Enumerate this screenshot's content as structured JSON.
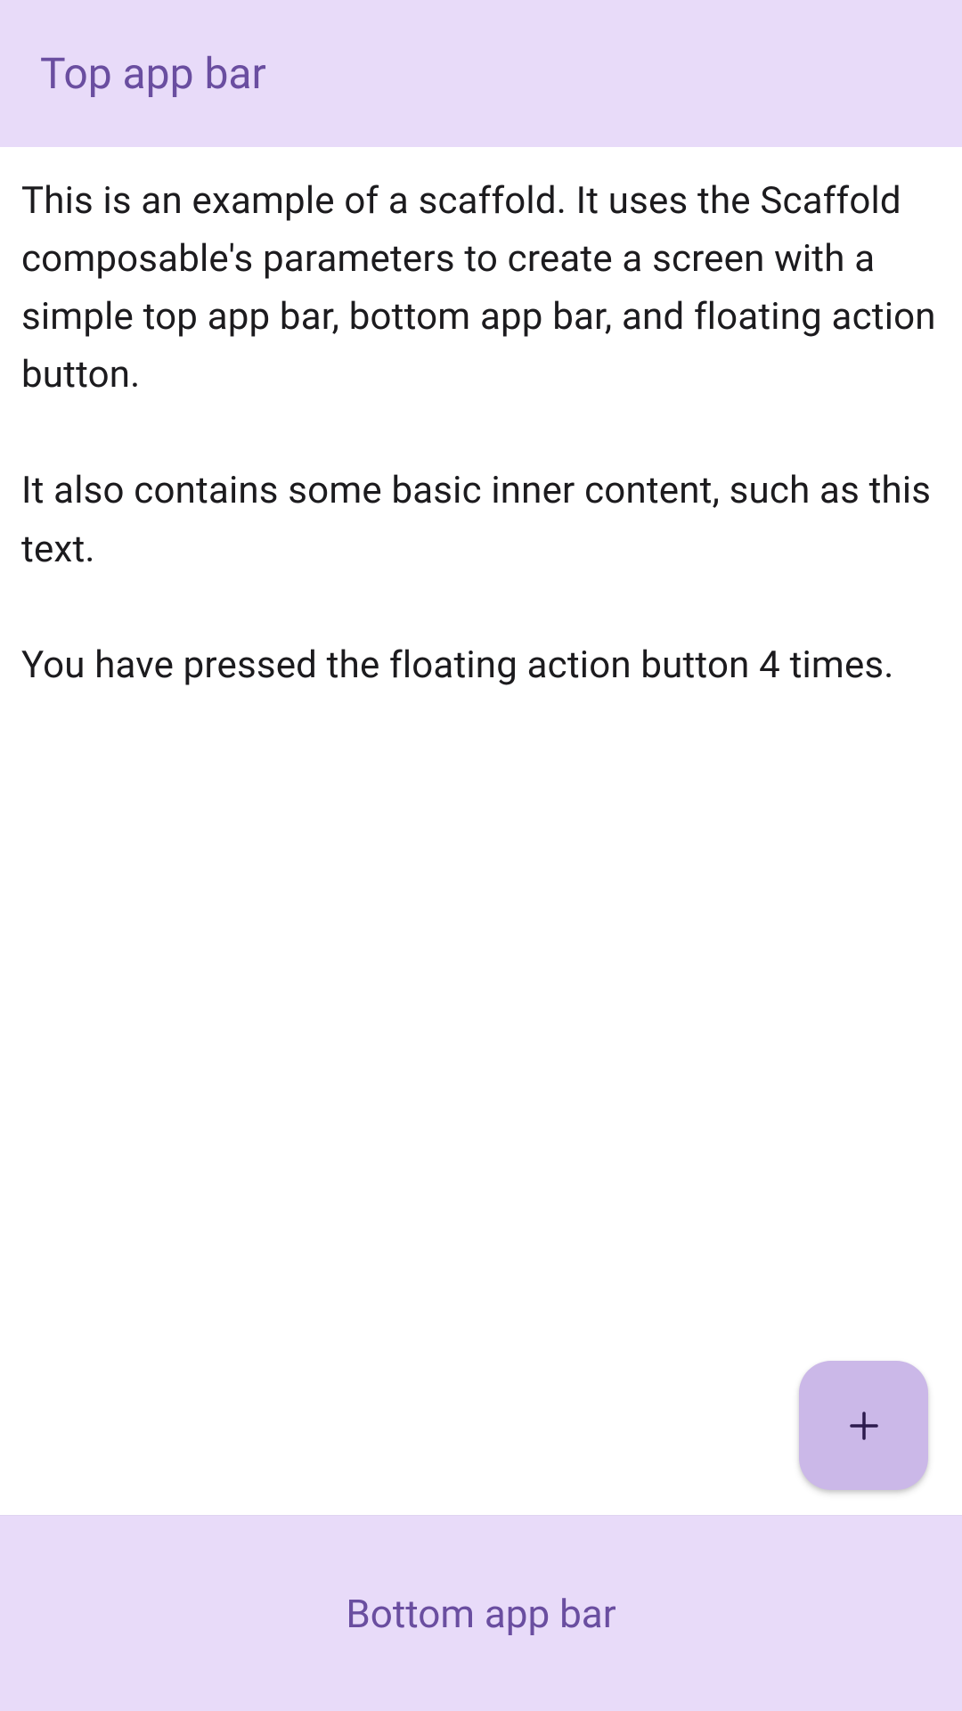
{
  "topBar": {
    "title": "Top app bar"
  },
  "content": {
    "paragraph1": "This is an example of a scaffold. It uses the Scaffold composable's parameters to create a screen with a simple top app bar, bottom app bar, and floating action button.",
    "paragraph2": "It also contains some basic inner content, such as this text.",
    "pressCountPrefix": "You have pressed the floating action button ",
    "pressCount": "4",
    "pressCountSuffix": " times."
  },
  "bottomBar": {
    "label": "Bottom app bar"
  },
  "colors": {
    "barBackground": "#e8dbf9",
    "barText": "#6a4ea0",
    "fabBackground": "#cbb8e8",
    "fabIcon": "#2d1b4e",
    "contentText": "#1c1b1e"
  }
}
